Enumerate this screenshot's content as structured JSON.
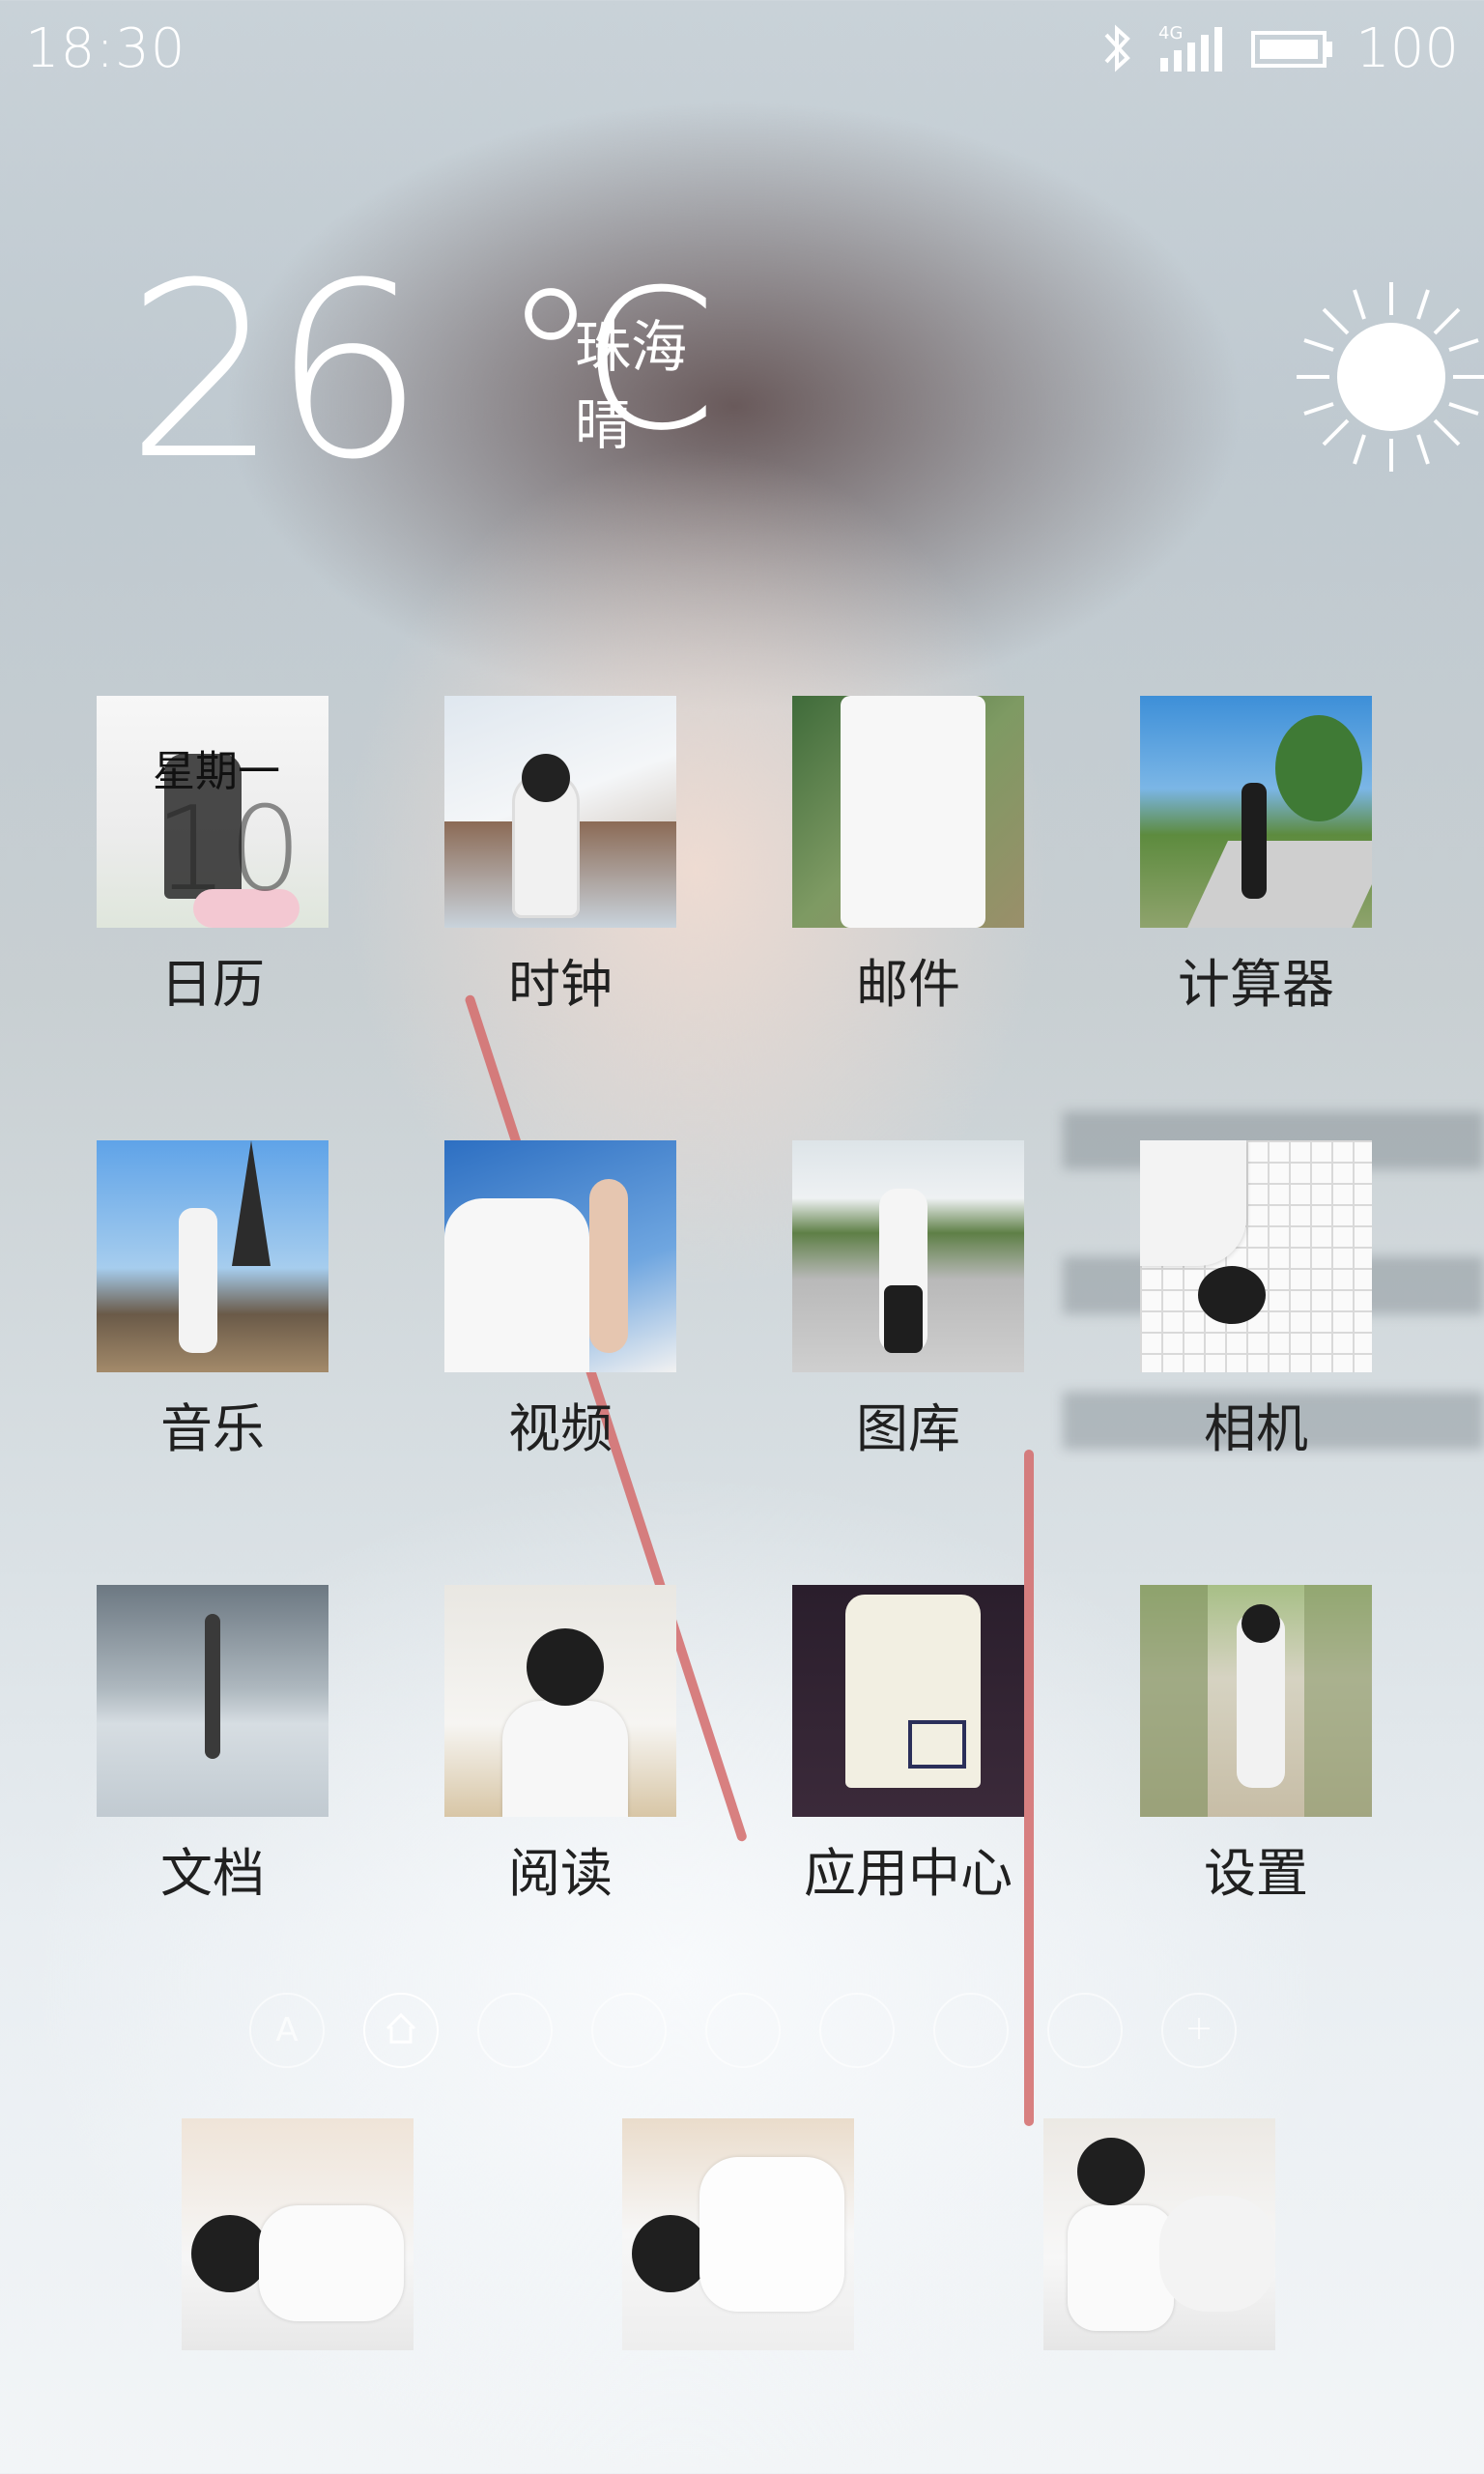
{
  "status_bar": {
    "time": "18:30",
    "network": "4G",
    "battery": "100",
    "icons": [
      "bluetooth-icon",
      "signal-4g-icon",
      "battery-icon"
    ]
  },
  "weather": {
    "temperature": "26",
    "unit": "℃",
    "city": "珠海",
    "condition": "晴",
    "icon": "sun-icon"
  },
  "calendar_widget": {
    "weekday": "星期一",
    "date": "10"
  },
  "apps": [
    {
      "label": "日历"
    },
    {
      "label": "时钟"
    },
    {
      "label": "邮件"
    },
    {
      "label": "计算器"
    },
    {
      "label": "音乐"
    },
    {
      "label": "视频"
    },
    {
      "label": "图库"
    },
    {
      "label": "相机"
    },
    {
      "label": "文档"
    },
    {
      "label": "阅读"
    },
    {
      "label": "应用中心"
    },
    {
      "label": "设置"
    }
  ],
  "page_indicators": {
    "count": 9,
    "active_index": 1,
    "first_letter": "A"
  },
  "dock_apps": 3
}
